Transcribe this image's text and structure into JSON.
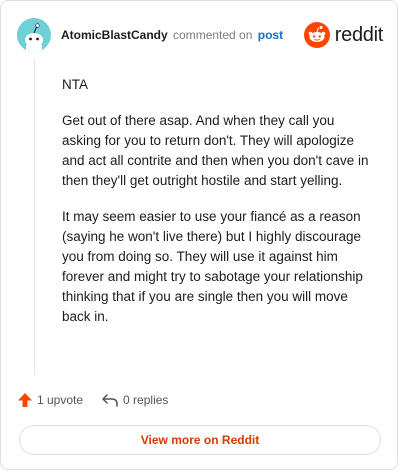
{
  "header": {
    "author": "AtomicBlastCandy",
    "verb": "commented on",
    "post_link": "post",
    "brand": "reddit"
  },
  "comment": {
    "paragraphs": [
      "NTA",
      "Get out of there asap. And when they call you asking for you to return don't. They will apologize and act all contrite and then when you don't cave in then they'll get outright hostile and start yelling.",
      "It may seem easier to use your fiancé as a reason (saying he won't live there) but I highly discourage you from doing so. They will use it against him forever and might try to sabotage your relationship thinking that if you are single then you will move back in."
    ]
  },
  "actions": {
    "upvotes": "1 upvote",
    "replies": "0 replies"
  },
  "footer": {
    "view_more": "View more on Reddit"
  },
  "colors": {
    "accent": "#ff4500",
    "link": "#1a6fc0",
    "view_more": "#d93a00"
  },
  "icons": [
    "avatar",
    "reddit-logo-icon",
    "upvote-arrow-icon",
    "reply-icon"
  ]
}
